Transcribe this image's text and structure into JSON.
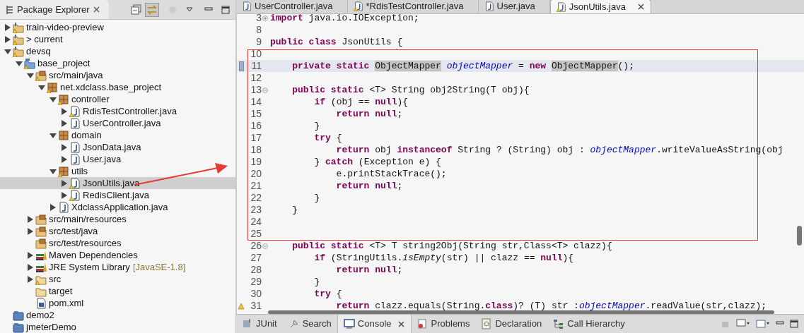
{
  "explorer": {
    "title": "Package Explorer",
    "tree": [
      {
        "label": "train-video-preview",
        "kind": "project",
        "warning": true,
        "expanded": false,
        "selected": false
      },
      {
        "label": "> current",
        "kind": "project",
        "warning": true,
        "expanded": false,
        "selected": false
      },
      {
        "label": "devsq",
        "kind": "project",
        "warning": true,
        "expanded": true,
        "selected": false,
        "children": [
          {
            "label": "base_project",
            "kind": "maven",
            "warning": true,
            "expanded": true,
            "selected": false,
            "children": [
              {
                "label": "src/main/java",
                "kind": "source",
                "warning": true,
                "expanded": true,
                "selected": false,
                "children": [
                  {
                    "label": "net.xdclass.base_project",
                    "kind": "package",
                    "warning": true,
                    "expanded": true,
                    "selected": false,
                    "children": [
                      {
                        "label": "controller",
                        "kind": "package",
                        "warning": true,
                        "expanded": true,
                        "selected": false,
                        "children": [
                          {
                            "label": "RdisTestController.java",
                            "kind": "java",
                            "warning": true,
                            "expanded": false,
                            "selected": false
                          },
                          {
                            "label": "UserController.java",
                            "kind": "java",
                            "warning": false,
                            "expanded": false,
                            "selected": false
                          }
                        ]
                      },
                      {
                        "label": "domain",
                        "kind": "package",
                        "warning": false,
                        "expanded": true,
                        "selected": false,
                        "children": [
                          {
                            "label": "JsonData.java",
                            "kind": "java",
                            "warning": false,
                            "expanded": false,
                            "selected": false
                          },
                          {
                            "label": "User.java",
                            "kind": "java",
                            "warning": false,
                            "expanded": false,
                            "selected": false
                          }
                        ]
                      },
                      {
                        "label": "utils",
                        "kind": "package",
                        "warning": true,
                        "expanded": true,
                        "selected": false,
                        "children": [
                          {
                            "label": "JsonUtils.java",
                            "kind": "java",
                            "warning": true,
                            "expanded": false,
                            "selected": true
                          },
                          {
                            "label": "RedisClient.java",
                            "kind": "java",
                            "warning": true,
                            "expanded": false,
                            "selected": false
                          }
                        ]
                      },
                      {
                        "label": "XdclassApplication.java",
                        "kind": "java",
                        "warning": false,
                        "expanded": false,
                        "selected": false
                      }
                    ]
                  }
                ]
              },
              {
                "label": "src/main/resources",
                "kind": "source",
                "warning": false,
                "expanded": false,
                "selected": false
              },
              {
                "label": "src/test/java",
                "kind": "source",
                "warning": false,
                "expanded": false,
                "selected": false
              },
              {
                "label": "src/test/resources",
                "kind": "source",
                "warning": false,
                "selected": false
              },
              {
                "label": "Maven Dependencies",
                "kind": "library",
                "warning": false,
                "expanded": false,
                "selected": false
              },
              {
                "label": "JRE System Library",
                "decoration": "[JavaSE-1.8]",
                "kind": "library",
                "warning": false,
                "expanded": false,
                "selected": false
              },
              {
                "label": "src",
                "kind": "folder",
                "warning": true,
                "expanded": false,
                "selected": false
              },
              {
                "label": "target",
                "kind": "folder",
                "warning": false,
                "selected": false
              },
              {
                "label": "pom.xml",
                "kind": "xml",
                "warning": false,
                "selected": false
              }
            ]
          }
        ]
      },
      {
        "label": "demo2",
        "kind": "closed",
        "warning": false,
        "selected": false
      },
      {
        "label": "jmeterDemo",
        "kind": "closed",
        "warning": false,
        "selected": false
      }
    ]
  },
  "editor_tabs": [
    {
      "label": "UserController.java",
      "warning": false,
      "selected": false
    },
    {
      "label": "*RdisTestController.java",
      "warning": true,
      "selected": false
    },
    {
      "label": "User.java",
      "warning": false,
      "selected": false
    },
    {
      "label": "JsonUtils.java",
      "warning": true,
      "selected": true
    }
  ],
  "code": [
    {
      "number": "3",
      "collapsed": true,
      "current": false,
      "tokens": [
        {
          "kind": "kw",
          "t": "import"
        },
        {
          "kind": "p",
          "t": " java.io.IOException;"
        }
      ]
    },
    {
      "number": "8",
      "current": false
    },
    {
      "number": "9",
      "current": false,
      "tokens": [
        {
          "kind": "kw",
          "t": "public class "
        },
        {
          "kind": "p",
          "t": "JsonUtils {"
        }
      ]
    },
    {
      "number": "10",
      "current": false
    },
    {
      "number": "11",
      "current": true,
      "tokens": [
        {
          "kind": "kw",
          "t": "    private static "
        },
        {
          "kind": "occ",
          "t": "ObjectMapper"
        },
        {
          "kind": "field",
          "t": " objectMapper"
        },
        {
          "kind": "p",
          "t": " = "
        },
        {
          "kind": "kw",
          "t": "new "
        },
        {
          "kind": "occ",
          "t": "ObjectMapper"
        },
        {
          "kind": "p",
          "t": "();"
        }
      ]
    },
    {
      "number": "12",
      "current": false
    },
    {
      "number": "13",
      "collapsed": false,
      "current": false,
      "tokens": [
        {
          "kind": "kw",
          "t": "    public static "
        },
        {
          "kind": "p",
          "t": "<T> String obj2String(T obj){"
        }
      ]
    },
    {
      "number": "14",
      "current": false,
      "tokens": [
        {
          "kind": "kw",
          "t": "        if "
        },
        {
          "kind": "p",
          "t": "(obj == "
        },
        {
          "kind": "kw",
          "t": "null"
        },
        {
          "kind": "p",
          "t": "){"
        }
      ]
    },
    {
      "number": "15",
      "current": false,
      "tokens": [
        {
          "kind": "kw",
          "t": "            return null"
        },
        {
          "kind": "p",
          "t": ";"
        }
      ]
    },
    {
      "number": "16",
      "current": false,
      "tokens": [
        {
          "kind": "p",
          "t": "        }"
        }
      ]
    },
    {
      "number": "17",
      "current": false,
      "tokens": [
        {
          "kind": "kw",
          "t": "        try "
        },
        {
          "kind": "p",
          "t": "{"
        }
      ]
    },
    {
      "number": "18",
      "current": false,
      "tokens": [
        {
          "kind": "kw",
          "t": "            return "
        },
        {
          "kind": "p",
          "t": "obj "
        },
        {
          "kind": "kw",
          "t": "instanceof "
        },
        {
          "kind": "p",
          "t": "String ? (String) obj : "
        },
        {
          "kind": "field",
          "t": "objectMapper"
        },
        {
          "kind": "p",
          "t": ".writeValueAsString(obj"
        }
      ]
    },
    {
      "number": "19",
      "current": false,
      "tokens": [
        {
          "kind": "p",
          "t": "        } "
        },
        {
          "kind": "kw",
          "t": "catch "
        },
        {
          "kind": "p",
          "t": "(Exception e) {"
        }
      ]
    },
    {
      "number": "20",
      "current": false,
      "tokens": [
        {
          "kind": "p",
          "t": "            e.printStackTrace();"
        }
      ]
    },
    {
      "number": "21",
      "current": false,
      "tokens": [
        {
          "kind": "kw",
          "t": "            return null"
        },
        {
          "kind": "p",
          "t": ";"
        }
      ]
    },
    {
      "number": "22",
      "current": false,
      "tokens": [
        {
          "kind": "p",
          "t": "        }"
        }
      ]
    },
    {
      "number": "23",
      "current": false,
      "tokens": [
        {
          "kind": "p",
          "t": "    }"
        }
      ]
    },
    {
      "number": "24",
      "current": false
    },
    {
      "number": "25",
      "current": false
    },
    {
      "number": "26",
      "collapsed": false,
      "current": false,
      "tokens": [
        {
          "kind": "kw",
          "t": "    public static "
        },
        {
          "kind": "p",
          "t": "<T> T string2Obj(String str,Class<T> clazz){"
        }
      ]
    },
    {
      "number": "27",
      "current": false,
      "tokens": [
        {
          "kind": "kw",
          "t": "        if "
        },
        {
          "kind": "p",
          "t": "(StringUtils."
        },
        {
          "kind": "static",
          "t": "isEmpty"
        },
        {
          "kind": "p",
          "t": "(str) || clazz == "
        },
        {
          "kind": "kw",
          "t": "null"
        },
        {
          "kind": "p",
          "t": "){"
        }
      ]
    },
    {
      "number": "28",
      "current": false,
      "tokens": [
        {
          "kind": "kw",
          "t": "            return null"
        },
        {
          "kind": "p",
          "t": ";"
        }
      ]
    },
    {
      "number": "29",
      "current": false,
      "tokens": [
        {
          "kind": "p",
          "t": "        }"
        }
      ]
    },
    {
      "number": "30",
      "current": false,
      "tokens": [
        {
          "kind": "kw",
          "t": "        try "
        },
        {
          "kind": "p",
          "t": "{"
        }
      ]
    },
    {
      "number": "31",
      "warning": true,
      "current": false,
      "tokens": [
        {
          "kind": "kw",
          "t": "            return "
        },
        {
          "kind": "p",
          "t": "clazz.equals(String."
        },
        {
          "kind": "kw",
          "t": "class"
        },
        {
          "kind": "p",
          "t": ")? (T) str :"
        },
        {
          "kind": "field",
          "t": "objectMapper"
        },
        {
          "kind": "p",
          "t": ".readValue(str,clazz);"
        }
      ]
    }
  ],
  "bottom_tabs": [
    {
      "label": "JUnit",
      "kind": "junit",
      "selected": false
    },
    {
      "label": "Search",
      "kind": "search",
      "selected": false
    },
    {
      "label": "Console",
      "kind": "console",
      "selected": true
    },
    {
      "label": "Problems",
      "kind": "problems",
      "selected": false
    },
    {
      "label": "Declaration",
      "kind": "declaration",
      "selected": false
    },
    {
      "label": "Call Hierarchy",
      "kind": "hierarchy",
      "selected": false
    }
  ]
}
